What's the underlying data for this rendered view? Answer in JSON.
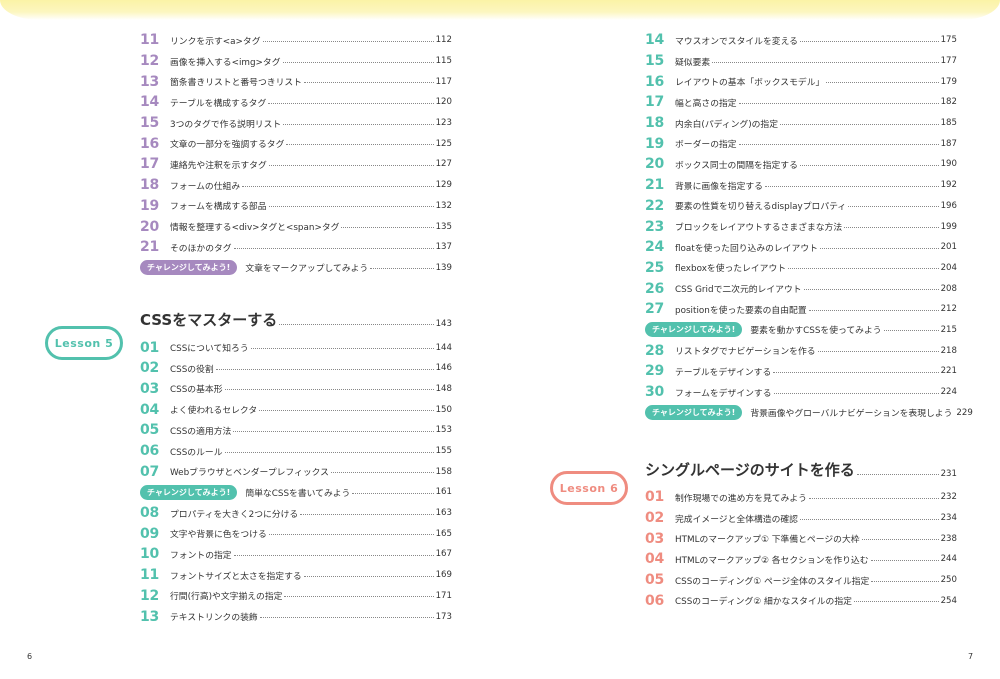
{
  "colors": {
    "purple": "#a689bf",
    "teal": "#52c1ad",
    "coral": "#ef8c80",
    "yellow": "#fbf3a6"
  },
  "left": {
    "items_a": [
      {
        "num": "11",
        "title": "リンクを示す<a>タグ",
        "page": "112"
      },
      {
        "num": "12",
        "title": "画像を挿入する<img>タグ",
        "page": "115"
      },
      {
        "num": "13",
        "title": "箇条書きリストと番号つきリスト",
        "page": "117"
      },
      {
        "num": "14",
        "title": "テーブルを構成するタグ",
        "page": "120"
      },
      {
        "num": "15",
        "title": "3つのタグで作る説明リスト",
        "page": "123"
      },
      {
        "num": "16",
        "title": "文章の一部分を強調するタグ",
        "page": "125"
      },
      {
        "num": "17",
        "title": "連絡先や注釈を示すタグ",
        "page": "127"
      },
      {
        "num": "18",
        "title": "フォームの仕組み",
        "page": "129"
      },
      {
        "num": "19",
        "title": "フォームを構成する部品",
        "page": "132"
      },
      {
        "num": "20",
        "title": "情報を整理する<div>タグと<span>タグ",
        "page": "135"
      },
      {
        "num": "21",
        "title": "そのほかのタグ",
        "page": "137"
      }
    ],
    "challenge_a": {
      "badge": "チャレンジしてみよう!",
      "title": "文章をマークアップしてみよう",
      "page": "139"
    },
    "lesson5": {
      "pill": "Lesson 5",
      "title": "CSSをマスターする",
      "page": "143"
    },
    "items_b": [
      {
        "num": "01",
        "title": "CSSについて知ろう",
        "page": "144"
      },
      {
        "num": "02",
        "title": "CSSの役割",
        "page": "146"
      },
      {
        "num": "03",
        "title": "CSSの基本形",
        "page": "148"
      },
      {
        "num": "04",
        "title": "よく使われるセレクタ",
        "page": "150"
      },
      {
        "num": "05",
        "title": "CSSの適用方法",
        "page": "153"
      },
      {
        "num": "06",
        "title": "CSSのルール",
        "page": "155"
      },
      {
        "num": "07",
        "title": "Webブラウザとベンダープレフィックス",
        "page": "158"
      }
    ],
    "challenge_b": {
      "badge": "チャレンジしてみよう!",
      "title": "簡単なCSSを書いてみよう",
      "page": "161"
    },
    "items_c": [
      {
        "num": "08",
        "title": "プロパティを大きく2つに分ける",
        "page": "163"
      },
      {
        "num": "09",
        "title": "文字や背景に色をつける",
        "page": "165"
      },
      {
        "num": "10",
        "title": "フォントの指定",
        "page": "167"
      },
      {
        "num": "11",
        "title": "フォントサイズと太さを指定する",
        "page": "169"
      },
      {
        "num": "12",
        "title": "行間(行高)や文字揃えの指定",
        "page": "171"
      },
      {
        "num": "13",
        "title": "テキストリンクの装飾",
        "page": "173"
      }
    ],
    "folio": "6"
  },
  "right": {
    "items_a": [
      {
        "num": "14",
        "title": "マウスオンでスタイルを変える",
        "page": "175"
      },
      {
        "num": "15",
        "title": "疑似要素",
        "page": "177"
      },
      {
        "num": "16",
        "title": "レイアウトの基本「ボックスモデル」",
        "page": "179"
      },
      {
        "num": "17",
        "title": "幅と高さの指定",
        "page": "182"
      },
      {
        "num": "18",
        "title": "内余白(パディング)の指定",
        "page": "185"
      },
      {
        "num": "19",
        "title": "ボーダーの指定",
        "page": "187"
      },
      {
        "num": "20",
        "title": "ボックス同士の間隔を指定する",
        "page": "190"
      },
      {
        "num": "21",
        "title": "背景に画像を指定する",
        "page": "192"
      },
      {
        "num": "22",
        "title": "要素の性質を切り替えるdisplayプロパティ",
        "page": "196"
      },
      {
        "num": "23",
        "title": "ブロックをレイアウトするさまざまな方法",
        "page": "199"
      },
      {
        "num": "24",
        "title": "floatを使った回り込みのレイアウト",
        "page": "201"
      },
      {
        "num": "25",
        "title": "flexboxを使ったレイアウト",
        "page": "204"
      },
      {
        "num": "26",
        "title": "CSS Gridで二次元的レイアウト",
        "page": "208"
      },
      {
        "num": "27",
        "title": "positionを使った要素の自由配置",
        "page": "212"
      }
    ],
    "challenge_a": {
      "badge": "チャレンジしてみよう!",
      "title": "要素を動かすCSSを使ってみよう",
      "page": "215"
    },
    "items_b": [
      {
        "num": "28",
        "title": "リストタグでナビゲーションを作る",
        "page": "218"
      },
      {
        "num": "29",
        "title": "テーブルをデザインする",
        "page": "221"
      },
      {
        "num": "30",
        "title": "フォームをデザインする",
        "page": "224"
      }
    ],
    "challenge_b": {
      "badge": "チャレンジしてみよう!",
      "title": "背景画像やグローバルナビゲーションを表現しよう",
      "page": "229"
    },
    "lesson6": {
      "pill": "Lesson 6",
      "title": "シングルページのサイトを作る",
      "page": "231"
    },
    "items_c": [
      {
        "num": "01",
        "title": "制作現場での進め方を見てみよう",
        "page": "232"
      },
      {
        "num": "02",
        "title": "完成イメージと全体構造の確認",
        "page": "234"
      },
      {
        "num": "03",
        "title": "HTMLのマークアップ① 下準備とページの大枠",
        "page": "238"
      },
      {
        "num": "04",
        "title": "HTMLのマークアップ② 各セクションを作り込む",
        "page": "244"
      },
      {
        "num": "05",
        "title": "CSSのコーディング① ページ全体のスタイル指定",
        "page": "250"
      },
      {
        "num": "06",
        "title": "CSSのコーディング② 細かなスタイルの指定",
        "page": "254"
      }
    ],
    "folio": "7"
  }
}
